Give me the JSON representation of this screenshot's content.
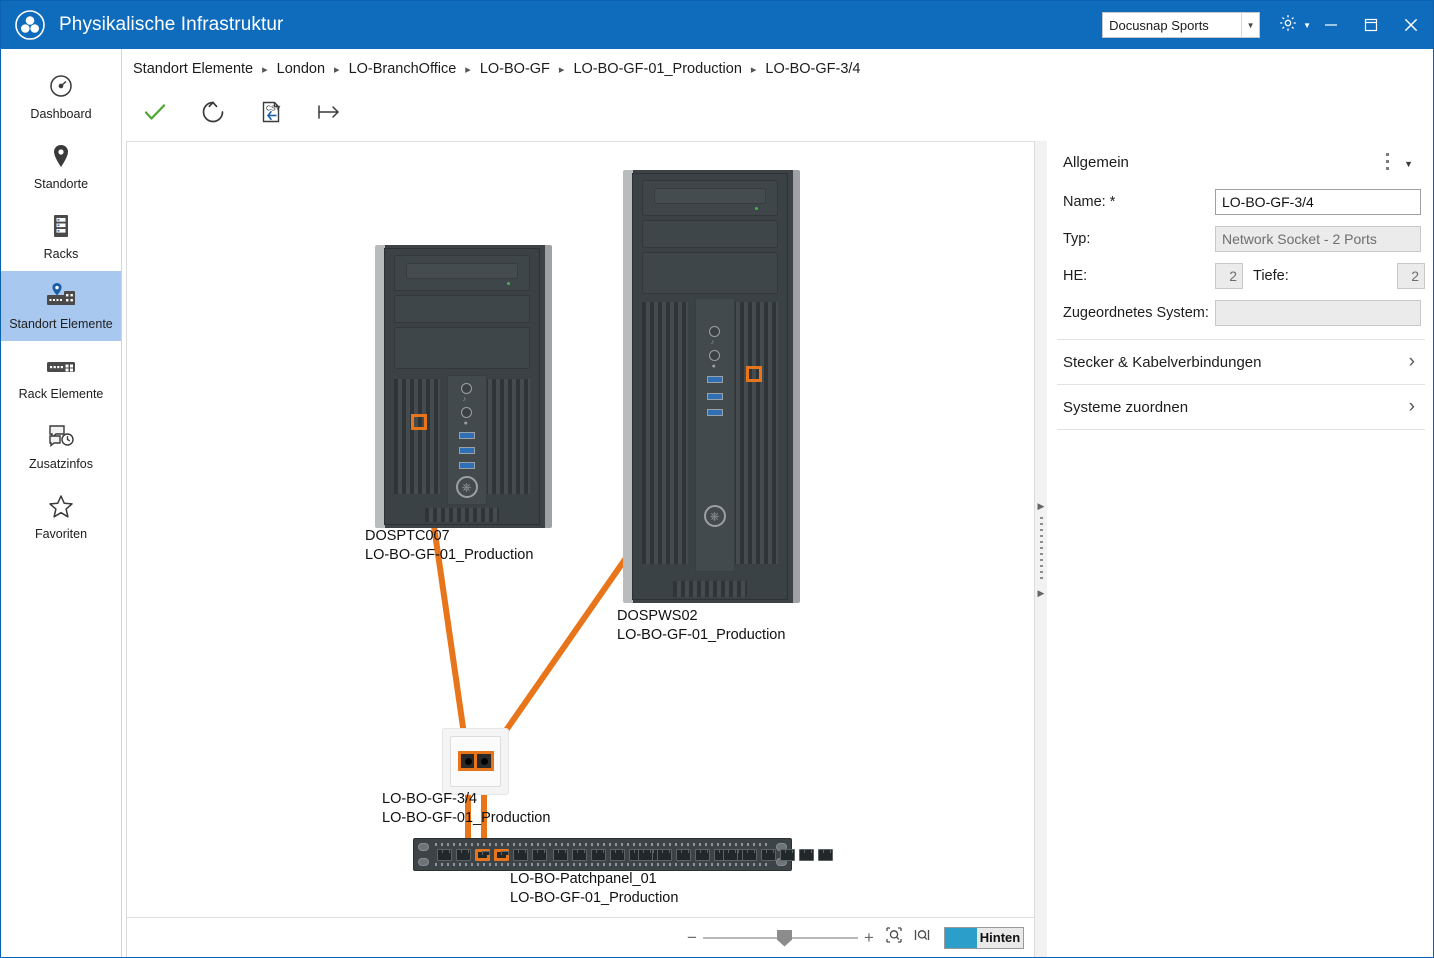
{
  "window": {
    "title": "Physikalische Infrastruktur",
    "logo_icon": "docusnap-logo-icon",
    "tenant_combo": {
      "value": "Docusnap Sports",
      "arrow_icon": "chevron-down-icon"
    },
    "settings_icon": "gear-icon",
    "settings_caret_icon": "chevron-down-icon",
    "minimize_icon": "minimize-icon",
    "maximize_icon": "maximize-icon",
    "close_icon": "close-icon",
    "accent_color": "#0f6cbd"
  },
  "sidebar": {
    "items": [
      {
        "label": "Dashboard",
        "icon": "gauge-icon",
        "active": false
      },
      {
        "label": "Standorte",
        "icon": "map-pin-icon",
        "active": false
      },
      {
        "label": "Racks",
        "icon": "rack-icon",
        "active": false
      },
      {
        "label": "Standort Elemente",
        "icon": "site-elements-icon",
        "active": true
      },
      {
        "label": "Rack Elemente",
        "icon": "rack-elements-icon",
        "active": false
      },
      {
        "label": "Zusatzinfos",
        "icon": "additional-info-icon",
        "active": false
      },
      {
        "label": "Favoriten",
        "icon": "star-icon",
        "active": false
      }
    ],
    "active_color": "#a8c8ef"
  },
  "breadcrumb": {
    "separator": "▸",
    "items": [
      "Standort Elemente",
      "London",
      "LO-BranchOffice",
      "LO-BO-GF",
      "LO-BO-GF-01_Production",
      "LO-BO-GF-3/4"
    ]
  },
  "toolbar": {
    "buttons": [
      {
        "name": "apply-button",
        "icon": "checkmark-icon",
        "color": "#4fa832"
      },
      {
        "name": "refresh-button",
        "icon": "refresh-icon",
        "color": "#3a3a3a"
      },
      {
        "name": "csv-import-button",
        "icon": "csv-import-icon",
        "color": "#3a3a3a"
      },
      {
        "name": "expand-button",
        "icon": "arrow-right-bar-icon",
        "color": "#3a3a3a"
      }
    ]
  },
  "canvas": {
    "cable_color": "#e8751a",
    "nodes": [
      {
        "id": "tower-left",
        "name_line1": "DOSPTC007",
        "name_line2": "LO-BO-GF-01_Production"
      },
      {
        "id": "tower-right",
        "name_line1": "DOSPWS02",
        "name_line2": "LO-BO-GF-01_Production"
      },
      {
        "id": "network-socket",
        "name_line1": "LO-BO-GF-3/4",
        "name_line2": "LO-BO-GF-01_Production"
      },
      {
        "id": "patch-panel",
        "name_line1": "LO-BO-Patchpanel_01",
        "name_line2": "LO-BO-GF-01_Production"
      }
    ],
    "patchpanel_groups": 4,
    "patchpanel_ports_per_group": 6,
    "patchpanel_highlighted_ports": [
      2,
      3
    ],
    "socket_ports": 2
  },
  "zoombar": {
    "minus_label": "−",
    "plus_label": "+",
    "zoom_percent": 50,
    "fit_icon": "zoom-fit-icon",
    "actual_icon": "zoom-actual-icon",
    "side_toggle": {
      "label": "Hinten",
      "swatch_color": "#2b9fc9"
    }
  },
  "splitter": {
    "collapse_up_icon": "triangle-right-icon",
    "collapse_down_icon": "triangle-right-icon",
    "grip_icon": "grip-dots-icon"
  },
  "panel": {
    "header": "Allgemein",
    "menu_icon": "kebab-menu-icon",
    "caret_icon": "chevron-down-icon",
    "fields": {
      "name_label": "Name: *",
      "name_value": "LO-BO-GF-3/4",
      "typ_label": "Typ:",
      "typ_value": "Network Socket - 2 Ports",
      "he_label": "HE:",
      "he_value": "2",
      "tiefe_label": "Tiefe:",
      "tiefe_value": "2",
      "system_label": "Zugeordnetes System:",
      "system_value": ""
    },
    "accordions": [
      {
        "label": "Stecker & Kabelverbindungen",
        "chevron_icon": "chevron-right-icon"
      },
      {
        "label": "Systeme zuordnen",
        "chevron_icon": "chevron-right-icon"
      }
    ]
  }
}
